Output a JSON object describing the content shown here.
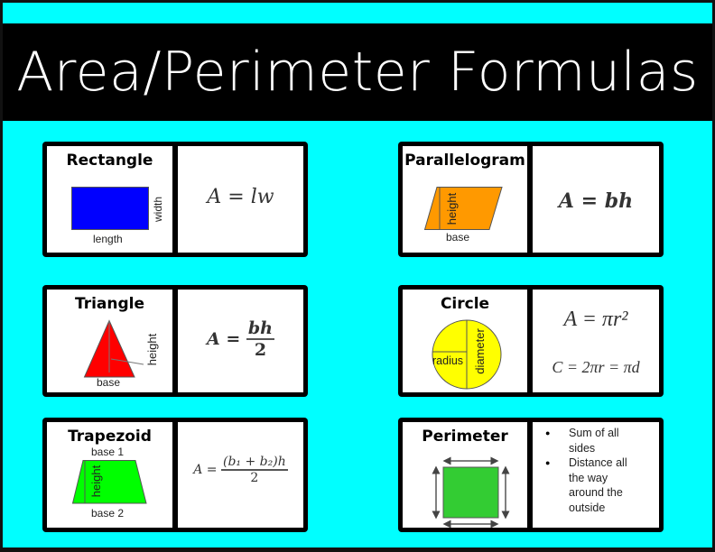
{
  "header": {
    "title": "Area/Perimeter Formulas"
  },
  "colors": {
    "background": "#00ffff",
    "header_bg": "#000000",
    "rectangle": "#0000ff",
    "parallelogram": "#ff9900",
    "triangle": "#ff0000",
    "circle": "#ffff00",
    "trapezoid": "#00ff00",
    "perimeter_square": "#33cc33"
  },
  "cards": {
    "rectangle": {
      "title": "Rectangle",
      "labels": {
        "length": "length",
        "width": "width"
      },
      "formula": "A = lw"
    },
    "parallelogram": {
      "title": "Parallelogram",
      "labels": {
        "height": "height",
        "base": "base"
      },
      "formula": "A = bh"
    },
    "triangle": {
      "title": "Triangle",
      "labels": {
        "height": "height",
        "base": "base"
      },
      "formula_lhs": "A =",
      "formula_num": "bh",
      "formula_den": "2"
    },
    "circle": {
      "title": "Circle",
      "labels": {
        "radius": "radius",
        "diameter": "diameter"
      },
      "formula_area": "A = πr²",
      "formula_circ": "C = 2πr = πd"
    },
    "trapezoid": {
      "title": "Trapezoid",
      "labels": {
        "base1": "base 1",
        "base2": "base 2",
        "height": "height"
      },
      "formula_lhs": "A =",
      "formula_num": "(b₁ + b₂)h",
      "formula_den": "2"
    },
    "perimeter": {
      "title": "Perimeter",
      "bullets": [
        "Sum of all sides",
        "Distance all the way around the outside"
      ]
    }
  }
}
